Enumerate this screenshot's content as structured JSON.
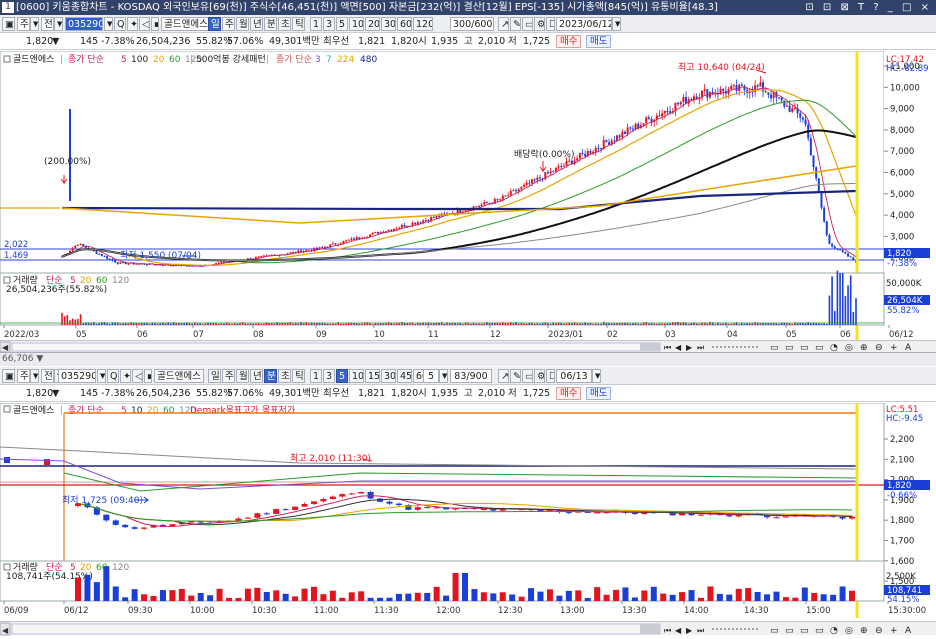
{
  "window": {
    "number": "1",
    "title": "[0600] 키움종합차트 - KOSDAQ 외국인보유[69(천)] 주식수[46,451(천)] 액면[500] 자본금[232(억)] 결산[12월] EPS[-135] 시가총액[845(억)] 유통비율[48.3]",
    "controls": "⊡ ⊡ ⊠ T ? _ □ ×"
  },
  "top": {
    "toolbar": {
      "type_label": "주",
      "jeon_label": "전",
      "code": "035290",
      "search_icon": "Q",
      "stock_name": "골드앤에스",
      "periods": [
        "일",
        "주",
        "월",
        "년",
        "분",
        "초",
        "틱"
      ],
      "active_period": "일",
      "intervals": [
        "1",
        "3",
        "5",
        "10",
        "20",
        "30",
        "60",
        "120"
      ],
      "count": "300/600",
      "date": "2023/06/12"
    },
    "info": {
      "price": "1,820",
      "arrow": "▼",
      "change": "145",
      "change_pct": "-7.38%",
      "volume": "26,504,236",
      "vol_ratio": "55.82%",
      "strength": "57.06%",
      "amount": "49,301백만",
      "best": "최우선",
      "bid": "1,821",
      "ask": "1,820",
      "open_label": "시",
      "open": "1,935",
      "high_label": "고",
      "high": "2,010",
      "low_label": "저",
      "low": "1,725",
      "buy": "매수",
      "sell": "매도"
    },
    "legend": {
      "name": "골드앤에스",
      "ma_label": "종가 단순",
      "ma": [
        "5",
        "100",
        "20",
        "60",
        "120"
      ],
      "pattern": "500억봉 강세패턴",
      "ma2_label": "종가 단순",
      "ma2": [
        "3",
        "7",
        "224",
        "480"
      ]
    },
    "vol_legend": {
      "label": "거래량",
      "kind": "단순",
      "ma": [
        "5",
        "20",
        "60",
        "120"
      ],
      "value": "26,504,236주(55.82%)"
    },
    "annotations": {
      "high": "최고 10,640 (04/24)",
      "low": "최저 1,550 (07/04)",
      "div1": "(200.00%)",
      "div2": "배당락(0.00%)",
      "left_a": "2,022",
      "left_b": "1,469"
    },
    "right": {
      "lc": "LC:17.42",
      "hc": "HC:-82.89",
      "price_box": "1,820",
      "price_pct": "-7.38%",
      "vol_box": "26,504K",
      "vol_pct": "55.82%",
      "vol_tick": "50,000K"
    },
    "y_ticks": [
      "11,000",
      "10,000",
      "9,000",
      "8,000",
      "7,000",
      "6,000",
      "5,000",
      "4,000",
      "3,000",
      "2,000"
    ],
    "x_ticks": [
      "2022/03",
      "05",
      "06",
      "07",
      "08",
      "09",
      "10",
      "11",
      "12",
      "2023/01",
      "02",
      "03",
      "04",
      "05",
      "06",
      "06/12"
    ]
  },
  "bottom": {
    "toolbar": {
      "type_label": "주",
      "jeon_label": "전",
      "code": "035290",
      "search_icon": "Q",
      "stock_name": "골드앤에스",
      "periods": [
        "일",
        "주",
        "월",
        "년",
        "분",
        "초",
        "틱"
      ],
      "active_period": "분",
      "intervals": [
        "1",
        "3",
        "5",
        "10",
        "15",
        "30",
        "45",
        "60"
      ],
      "active_interval": "5",
      "sel_value": "5",
      "count": "83/900",
      "date": "06/13"
    },
    "info": {
      "price": "1,820",
      "arrow": "▼",
      "change": "145",
      "change_pct": "-7.38%",
      "volume": "26,504,236",
      "vol_ratio": "55.82%",
      "strength": "57.06%",
      "amount": "49,301백만",
      "best": "최우선",
      "bid": "1,821",
      "ask": "1,820",
      "open_label": "시",
      "open": "1,935",
      "high_label": "고",
      "high": "2,010",
      "low_label": "저",
      "low": "1,725",
      "buy": "매수",
      "sell": "매도"
    },
    "legend": {
      "name": "골드앤에스",
      "ma_label": "종가 단순",
      "ma": [
        "5",
        "10",
        "20",
        "60",
        "120"
      ],
      "demark": "Demark목표고가",
      "demark2": "목표저가"
    },
    "vol_legend": {
      "label": "거래량",
      "kind": "단순",
      "ma": [
        "5",
        "20",
        "60",
        "120"
      ],
      "value": "108,741주(54.15%)"
    },
    "annotations": {
      "high": "최고 2,010 (11:30)",
      "low": "최저 1,725 (09:40)"
    },
    "right": {
      "lc": "LC:5.51",
      "hc": "HC:-9.45",
      "price_box": "1,820",
      "price_pct": "-0.66%",
      "vol_box": "108,741",
      "vol_pct": "54.15%",
      "vol_tick": "2,500K"
    },
    "y_ticks": [
      "2,200",
      "2,100",
      "2,000",
      "1,900",
      "1,800",
      "1,700",
      "1,600",
      "1,500"
    ],
    "x_ticks": [
      "06/09",
      "06/12",
      "09:30",
      "10:00",
      "10:30",
      "11:00",
      "11:30",
      "12:00",
      "12:30",
      "13:00",
      "13:30",
      "14:00",
      "14:30",
      "15:00",
      "15:30:00"
    ]
  },
  "overlap_header": "66,706 ▼"
}
